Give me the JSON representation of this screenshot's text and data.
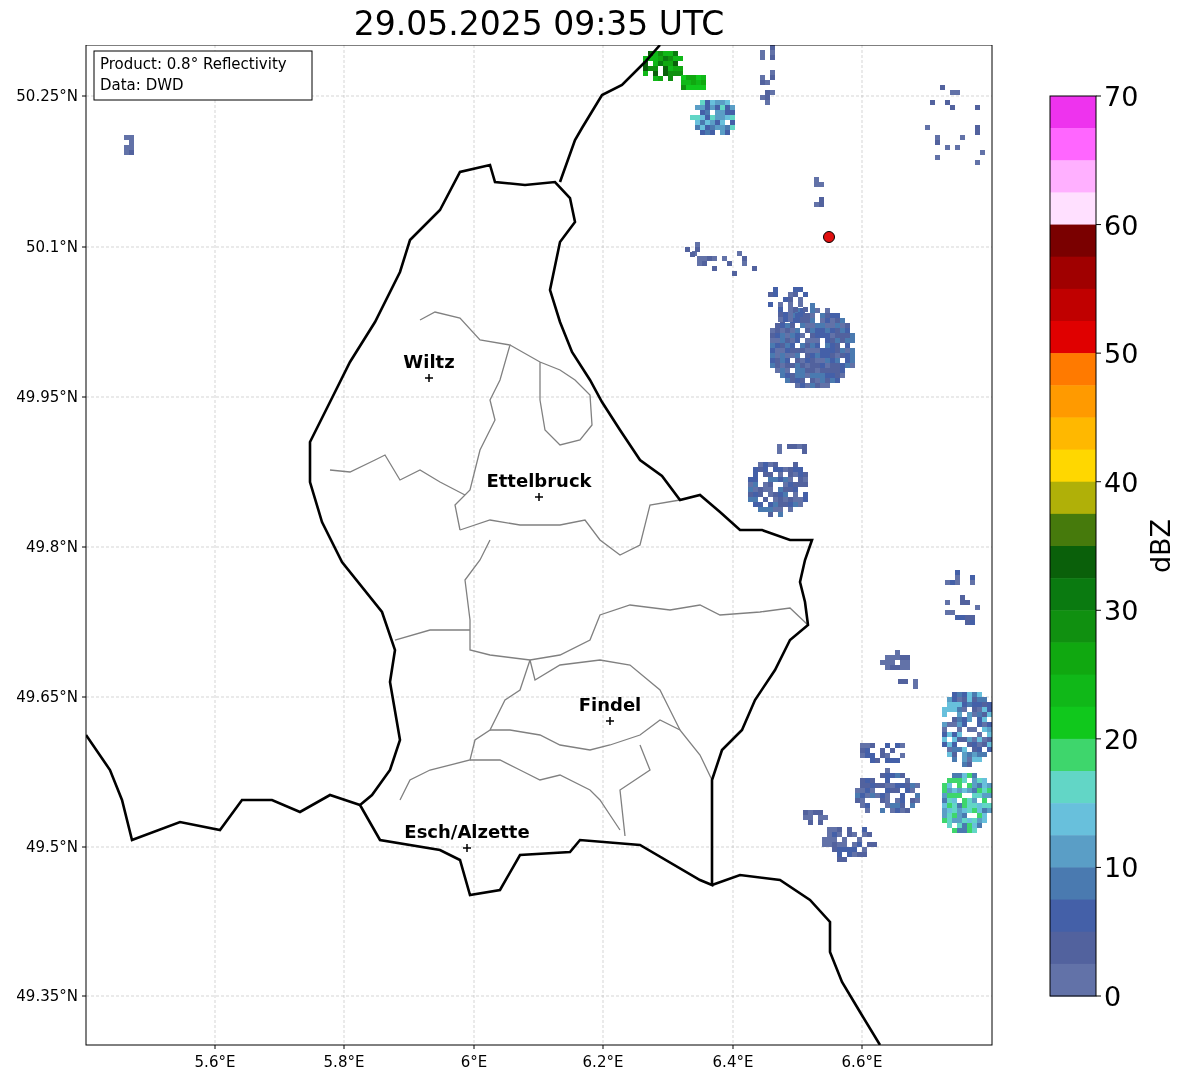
{
  "title": "29.05.2025 09:35 UTC",
  "info": [
    "Product: 0.8° Reflectivity",
    "Data: DWD"
  ],
  "map": {
    "xticks": [
      "5.6°E",
      "5.8°E",
      "6°E",
      "6.2°E",
      "6.4°E",
      "6.6°E"
    ],
    "yticks": [
      "50.25°N",
      "50.1°N",
      "49.95°N",
      "49.8°N",
      "49.65°N",
      "49.5°N",
      "49.35°N"
    ],
    "cities": [
      {
        "name": "Wiltz"
      },
      {
        "name": "Ettelbruck"
      },
      {
        "name": "Findel"
      },
      {
        "name": "Esch/Alzette"
      }
    ]
  },
  "colorbar": {
    "label": "dBZ",
    "ticks": [
      "70",
      "60",
      "50",
      "40",
      "30",
      "20",
      "10",
      "0"
    ],
    "bands": [
      {
        "color": "#ee33ee"
      },
      {
        "color": "#ff66ff"
      },
      {
        "color": "#ffb0ff"
      },
      {
        "color": "#ffe0ff"
      },
      {
        "color": "#7a0000"
      },
      {
        "color": "#a00000"
      },
      {
        "color": "#c00000"
      },
      {
        "color": "#e00000"
      },
      {
        "color": "#ff7a00"
      },
      {
        "color": "#ff9a00"
      },
      {
        "color": "#ffb800"
      },
      {
        "color": "#ffd700"
      },
      {
        "color": "#b0b008"
      },
      {
        "color": "#467a0c"
      },
      {
        "color": "#0a600a"
      },
      {
        "color": "#0a7a10"
      },
      {
        "color": "#109010"
      },
      {
        "color": "#10a810"
      },
      {
        "color": "#10b818"
      },
      {
        "color": "#10c81c"
      },
      {
        "color": "#3ed66c"
      },
      {
        "color": "#62d6c6"
      },
      {
        "color": "#68c0dc"
      },
      {
        "color": "#5a9ec6"
      },
      {
        "color": "#4a7ab0"
      },
      {
        "color": "#4460a8"
      },
      {
        "color": "#52629e"
      },
      {
        "color": "#6272a8"
      }
    ]
  }
}
